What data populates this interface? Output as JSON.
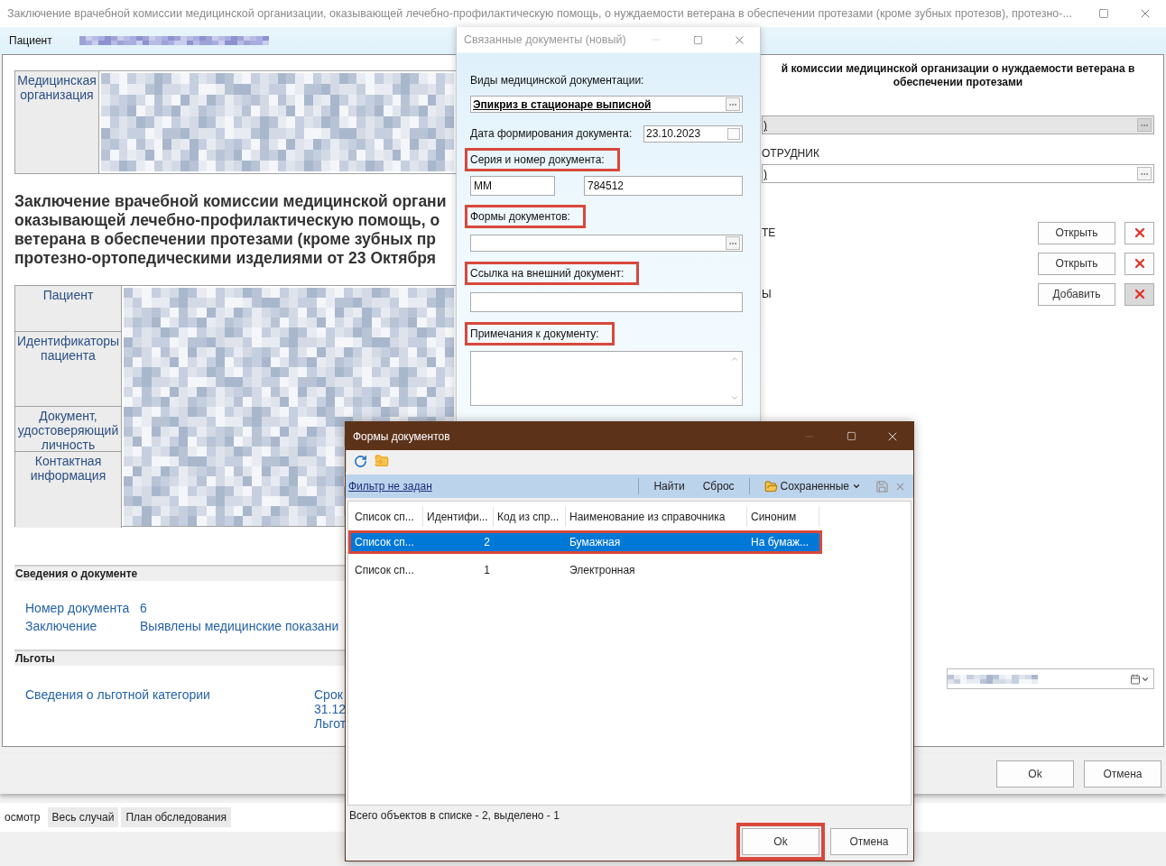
{
  "main_window": {
    "title": "Заключение врачебной комиссии медицинской организации, оказывающей лечебно-профилактическую помощь, о нуждаемости ветерана в обеспечении протезами (кроме зубных протезов), протезно-...",
    "patient_bar": {
      "label": "Пациент"
    },
    "organization": {
      "label": "Медицинская организация"
    },
    "heading_lines": [
      "Заключение врачебной комиссии медицинской органи",
      "оказывающей лечебно-профилактическую помощь, о",
      "ветерана в обеспечении протезами (кроме зубных пр",
      "протезно-ортопедическими изделиями от 23 Октября"
    ],
    "patient_table": {
      "rows": [
        {
          "label": "Пациент"
        },
        {
          "label": "Идентификаторы пациента"
        },
        {
          "label": "Документ, удостоверяющий личность"
        },
        {
          "label": "Контактная информация"
        }
      ]
    },
    "document_section": {
      "title": "Сведения о документе",
      "fields": [
        {
          "label": "Номер документа",
          "value": "6"
        },
        {
          "label": "Заключение",
          "value": "Выявлены медицинские показани"
        }
      ]
    },
    "benefits_section": {
      "title": "Льготы",
      "label": "Сведения о льготной категории",
      "value_lines": [
        "Срок",
        "31.12",
        "Льгот"
      ]
    },
    "right_panel": {
      "heading_lines": [
        "й комиссии медицинской организации о нуждаемости ветерана в",
        "обеспечении протезами"
      ],
      "field_1": {
        "value": ")",
        "disabled": true
      },
      "employee_label": "ОТРУДНИК",
      "field_2": {
        "value": ")",
        "disabled": false
      },
      "rows": [
        {
          "label": "ТЕ",
          "button": "Открыть",
          "delete_pressed": false
        },
        {
          "button": "Открыть",
          "delete_pressed": false
        },
        {
          "label": "Ы",
          "button": "Добавить",
          "delete_pressed": true
        }
      ]
    },
    "footer_buttons": [
      "Ok",
      "Отмена"
    ],
    "tabs": [
      {
        "label": "осмотр",
        "selected": true
      },
      {
        "label": "Весь случай",
        "selected": false
      },
      {
        "label": "План обследования",
        "selected": false
      }
    ]
  },
  "related_documents_dialog": {
    "title": "Связанные документы (новый)",
    "doc_type": {
      "label": "Виды медицинской документации:",
      "value": "Эпикриз в стационаре выписной",
      "highlighted": false
    },
    "date": {
      "label": "Дата формирования документа:",
      "value": "23.10.2023"
    },
    "series": {
      "label": "Серия и номер документа:",
      "highlighted": true,
      "series_value": "ММ",
      "number_value": "784512"
    },
    "forms": {
      "label": "Формы документов:",
      "highlighted": true
    },
    "link": {
      "label": "Ссылка на внешний документ:",
      "highlighted": true
    },
    "notes": {
      "label": "Примечания к документу:",
      "highlighted": true
    }
  },
  "document_forms_dialog": {
    "title": "Формы документов",
    "filter_link": "Фильтр не задан",
    "find": "Найти",
    "reset": "Сброс",
    "saved": "Сохраненные",
    "columns": [
      "Список сп...",
      "Идентифи...",
      "Код из спр...",
      "Наименование из справочника",
      "Синоним"
    ],
    "rows": [
      {
        "cells": [
          "Список сп...",
          "2",
          "",
          "Бумажная",
          "На бумаж..."
        ],
        "selected": true,
        "highlighted": true
      },
      {
        "cells": [
          "Список сп...",
          "1",
          "",
          "Электронная",
          ""
        ],
        "selected": false,
        "highlighted": false
      }
    ],
    "status": "Всего объектов в списке - 2, выделено - 1",
    "buttons": [
      {
        "label": "Ok",
        "highlighted": true
      },
      {
        "label": "Отмена",
        "highlighted": false
      }
    ]
  }
}
